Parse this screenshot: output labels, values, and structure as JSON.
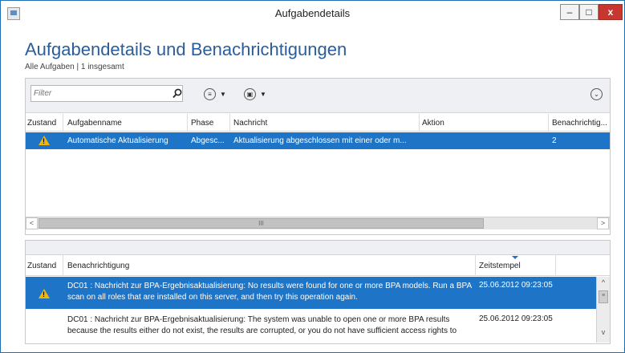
{
  "window": {
    "title": "Aufgabendetails",
    "min_label": "‒",
    "max_label": "□",
    "close_label": "x"
  },
  "header": {
    "title": "Aufgabendetails und Benachrichtigungen",
    "subtitle": "Alle Aufgaben | 1 insgesamt"
  },
  "tasks": {
    "filter_placeholder": "Filter",
    "columns": [
      "Zustand",
      "Aufgabenname",
      "Phase",
      "Nachricht",
      "Aktion",
      "Benachrichtig..."
    ],
    "rows": [
      {
        "status_icon": "warning-icon",
        "name": "Automatische Aktualisierung",
        "phase": "Abgesc...",
        "message": "Aktualisierung abgeschlossen mit einer oder m...",
        "action": "",
        "notifications": "2",
        "selected": true
      }
    ],
    "scroll_thumb_label": "III",
    "scroll_left": "<",
    "scroll_right": ">"
  },
  "notifications": {
    "columns": [
      "Zustand",
      "Benachrichtigung",
      "Zeitstempel"
    ],
    "rows": [
      {
        "status_icon": "warning-icon",
        "text": "DC01 : Nachricht zur BPA-Ergebnisaktualisierung: No results were found for one or more BPA models. Run a BPA scan on all roles that are installed on this server, and then try this operation again.",
        "timestamp": "25.06.2012 09:23:05",
        "selected": true
      },
      {
        "status_icon": "",
        "text": "DC01 : Nachricht zur BPA-Ergebnisaktualisierung: The system was unable to open one or more BPA results because the results either do not exist, the results are corrupted, or you do not have sufficient access rights to",
        "timestamp": "25.06.2012 09:23:05",
        "selected": false
      }
    ],
    "scroll_up": "^",
    "scroll_down": "v",
    "scroll_thumb_label": "≡"
  },
  "colors": {
    "accent": "#1e74c6",
    "title_blue": "#2a5d9a",
    "warning": "#f2b705",
    "close": "#c7372f"
  }
}
